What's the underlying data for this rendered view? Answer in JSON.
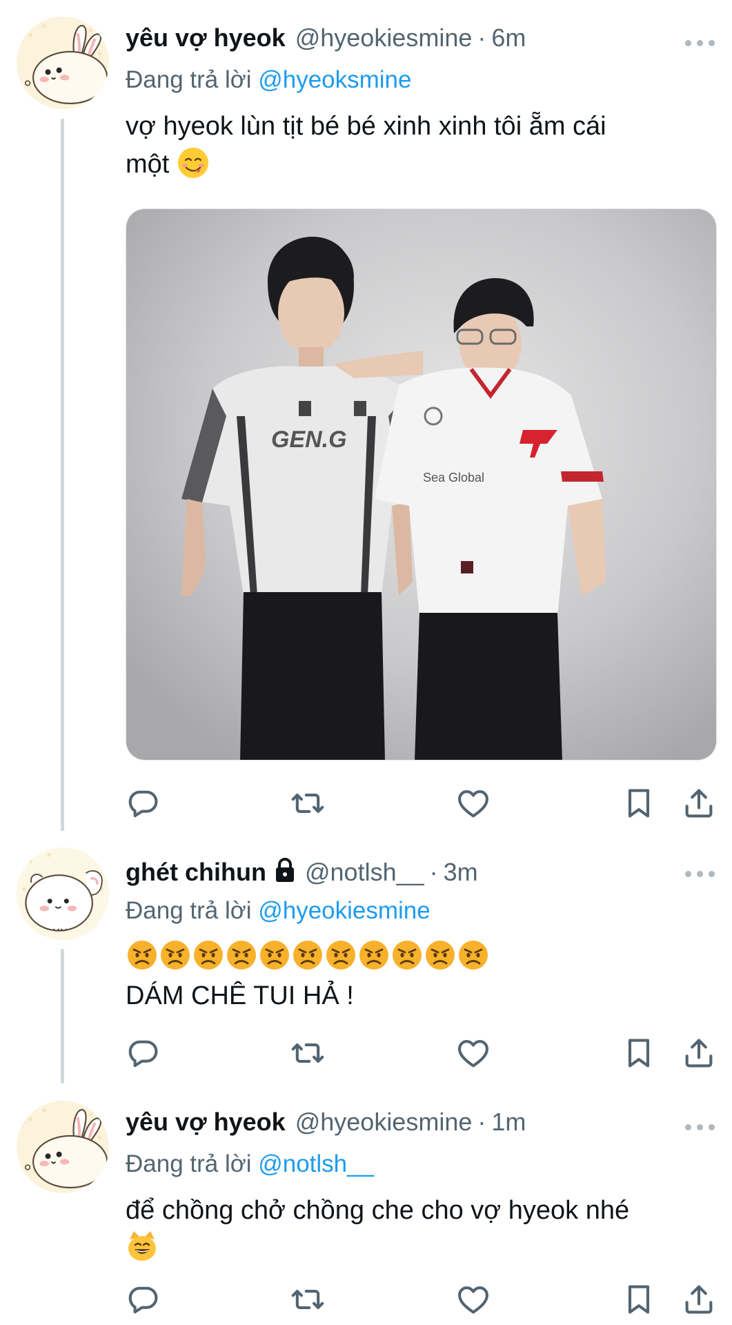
{
  "tweets": [
    {
      "name": "yêu vợ hyeok",
      "handle": "@hyeokiesmine",
      "time": "6m",
      "reply_prefix": "Đang trả lời",
      "reply_to": "@hyeoksmine",
      "text": "vợ hyeok lùn tịt bé bé xinh xinh tôi ẵm cái\nmột",
      "text_emoji": "face-savoring-food-emoji",
      "media_description_icon": "photo-two-players"
    },
    {
      "name": "ghét chihun",
      "protected": true,
      "handle": "@notlsh__",
      "time": "3m",
      "reply_prefix": "Đang trả lời",
      "reply_to": "@hyeokiesmine",
      "emoji_count": 11,
      "emoji_icon": "angry-face-emoji",
      "text": "DÁM CHÊ TUI HẢ !"
    },
    {
      "name": "yêu vợ hyeok",
      "handle": "@hyeokiesmine",
      "time": "1m",
      "reply_prefix": "Đang trả lời",
      "reply_to": "@notlsh__",
      "text": "để chồng chở chồng che cho vợ hyeok nhé",
      "text_emoji": "grinning-cat-emoji"
    }
  ],
  "separator": "·",
  "colors": {
    "link": "#1d9bf0",
    "secondary_text": "#536471",
    "thread_line": "#cfd9de",
    "icon": "#536471"
  },
  "actions": [
    "reply-icon",
    "retweet-icon",
    "like-icon",
    "bookmark-icon",
    "share-icon"
  ]
}
